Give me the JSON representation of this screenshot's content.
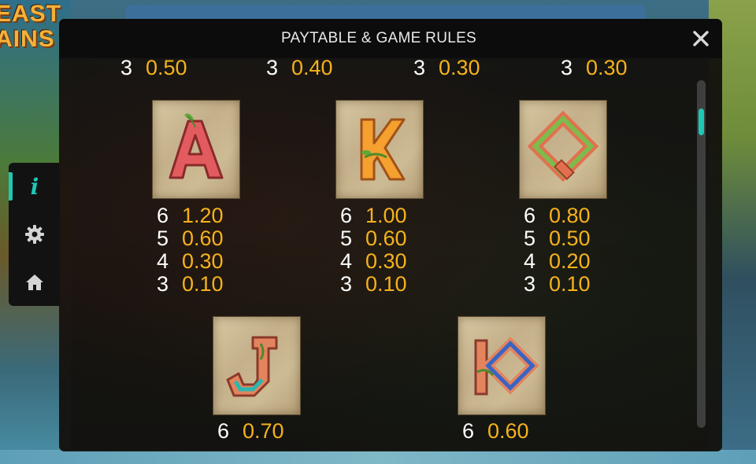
{
  "background": {
    "logo_text": "EAST\nAINS"
  },
  "side_menu": {
    "items": [
      {
        "icon": "info-icon",
        "active": true
      },
      {
        "icon": "gear-icon",
        "active": false
      },
      {
        "icon": "home-icon",
        "active": false
      }
    ]
  },
  "modal": {
    "title": "PAYTABLE & GAME RULES",
    "close_icon": "close-icon"
  },
  "paytable": {
    "top_row": [
      {
        "count": "3",
        "value": "0.50"
      },
      {
        "count": "3",
        "value": "0.40"
      },
      {
        "count": "3",
        "value": "0.30"
      },
      {
        "count": "3",
        "value": "0.30"
      }
    ],
    "symbols": [
      {
        "symbol": "A",
        "color": "#e0595e",
        "pays": [
          {
            "count": "6",
            "value": "1.20"
          },
          {
            "count": "5",
            "value": "0.60"
          },
          {
            "count": "4",
            "value": "0.30"
          },
          {
            "count": "3",
            "value": "0.10"
          }
        ]
      },
      {
        "symbol": "K",
        "color": "#f39a2e",
        "pays": [
          {
            "count": "6",
            "value": "1.00"
          },
          {
            "count": "5",
            "value": "0.60"
          },
          {
            "count": "4",
            "value": "0.30"
          },
          {
            "count": "3",
            "value": "0.10"
          }
        ]
      },
      {
        "symbol": "Q",
        "color": "#79b94a",
        "pays": [
          {
            "count": "6",
            "value": "0.80"
          },
          {
            "count": "5",
            "value": "0.50"
          },
          {
            "count": "4",
            "value": "0.20"
          },
          {
            "count": "3",
            "value": "0.10"
          }
        ]
      },
      {
        "symbol": "J",
        "color": "#2bb7b0",
        "pays": [
          {
            "count": "6",
            "value": "0.70"
          }
        ]
      },
      {
        "symbol": "10",
        "color": "#3a64c4",
        "pays": [
          {
            "count": "6",
            "value": "0.60"
          }
        ]
      }
    ]
  },
  "colors": {
    "accent": "#1fc7b4",
    "value_gold": "#f6b21b",
    "count_white": "#ffffff"
  }
}
